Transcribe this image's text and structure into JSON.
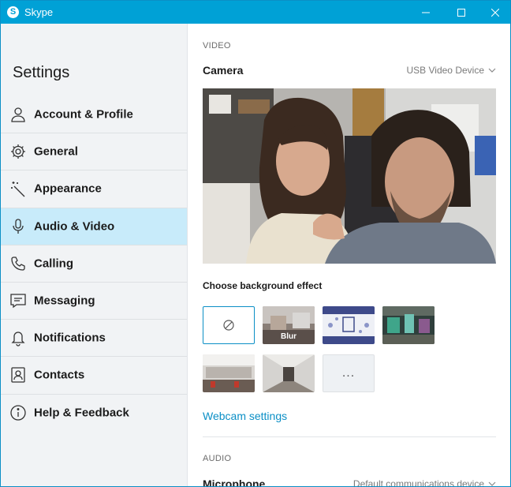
{
  "window": {
    "title": "Skype",
    "app_icon_letter": "S",
    "accent": "#00a1d6"
  },
  "sidebar": {
    "heading": "Settings",
    "items": [
      {
        "label": "Account & Profile",
        "icon": "person-icon",
        "active": false
      },
      {
        "label": "General",
        "icon": "gear-icon",
        "active": false
      },
      {
        "label": "Appearance",
        "icon": "magic-wand-icon",
        "active": false
      },
      {
        "label": "Audio & Video",
        "icon": "microphone-icon",
        "active": true
      },
      {
        "label": "Calling",
        "icon": "phone-icon",
        "active": false
      },
      {
        "label": "Messaging",
        "icon": "chat-icon",
        "active": false
      },
      {
        "label": "Notifications",
        "icon": "bell-icon",
        "active": false
      },
      {
        "label": "Contacts",
        "icon": "contact-card-icon",
        "active": false
      },
      {
        "label": "Help & Feedback",
        "icon": "info-icon",
        "active": false
      }
    ]
  },
  "main": {
    "video_section": "VIDEO",
    "camera_label": "Camera",
    "camera_device": "USB Video Device",
    "background_label": "Choose background effect",
    "effects": [
      {
        "name": "none",
        "label": ""
      },
      {
        "name": "blur",
        "label": "Blur"
      },
      {
        "name": "winter-pattern",
        "label": ""
      },
      {
        "name": "room-scene",
        "label": ""
      },
      {
        "name": "office-scene",
        "label": ""
      },
      {
        "name": "hallway-scene",
        "label": ""
      },
      {
        "name": "more",
        "label": "..."
      }
    ],
    "webcam_settings": "Webcam settings",
    "audio_section": "AUDIO",
    "microphone_label": "Microphone",
    "microphone_device": "Default communications device"
  }
}
